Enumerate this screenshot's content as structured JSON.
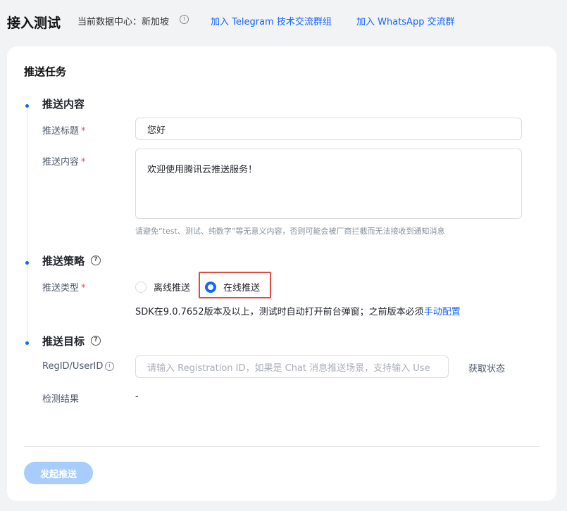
{
  "header": {
    "title": "接入测试",
    "datacenter_label": "当前数据中心：新加坡",
    "info_glyph": "i",
    "telegram_link": "加入 Telegram 技术交流群组",
    "whatsapp_link": "加入 WhatsApp 交流群"
  },
  "card": {
    "title": "推送任务"
  },
  "content_section": {
    "title": "推送内容",
    "title_label": "推送标题",
    "title_value": "您好",
    "content_label": "推送内容",
    "content_value": "欢迎使用腾讯云推送服务！",
    "hint": "请避免“test、测试、纯数字”等无意义内容，否则可能会被厂商拦截而无法接收到通知消息",
    "required_mark": "*"
  },
  "strategy_section": {
    "title": "推送策略",
    "help_glyph": "?",
    "type_label": "推送类型",
    "options": [
      {
        "label": "离线推送",
        "selected": false
      },
      {
        "label": "在线推送",
        "selected": true
      }
    ],
    "sdk_note": "SDK在9.0.7652版本及以上，测试时自动打开前台弹窗；之前版本必须",
    "sdk_link": "手动配置"
  },
  "target_section": {
    "title": "推送目标",
    "help_glyph": "?",
    "regid_label": "RegID/UserID",
    "regid_placeholder": "请输入 Registration ID，如果是 Chat 消息推送场景，支持输入 Use",
    "status_button": "获取状态",
    "result_label": "检测结果",
    "result_value": "-"
  },
  "footer": {
    "submit_label": "发起推送"
  },
  "colors": {
    "accent": "#1664ff",
    "highlight_border": "#e24a3b",
    "submit_disabled": "#a9cdfb",
    "required": "#e34d59"
  }
}
